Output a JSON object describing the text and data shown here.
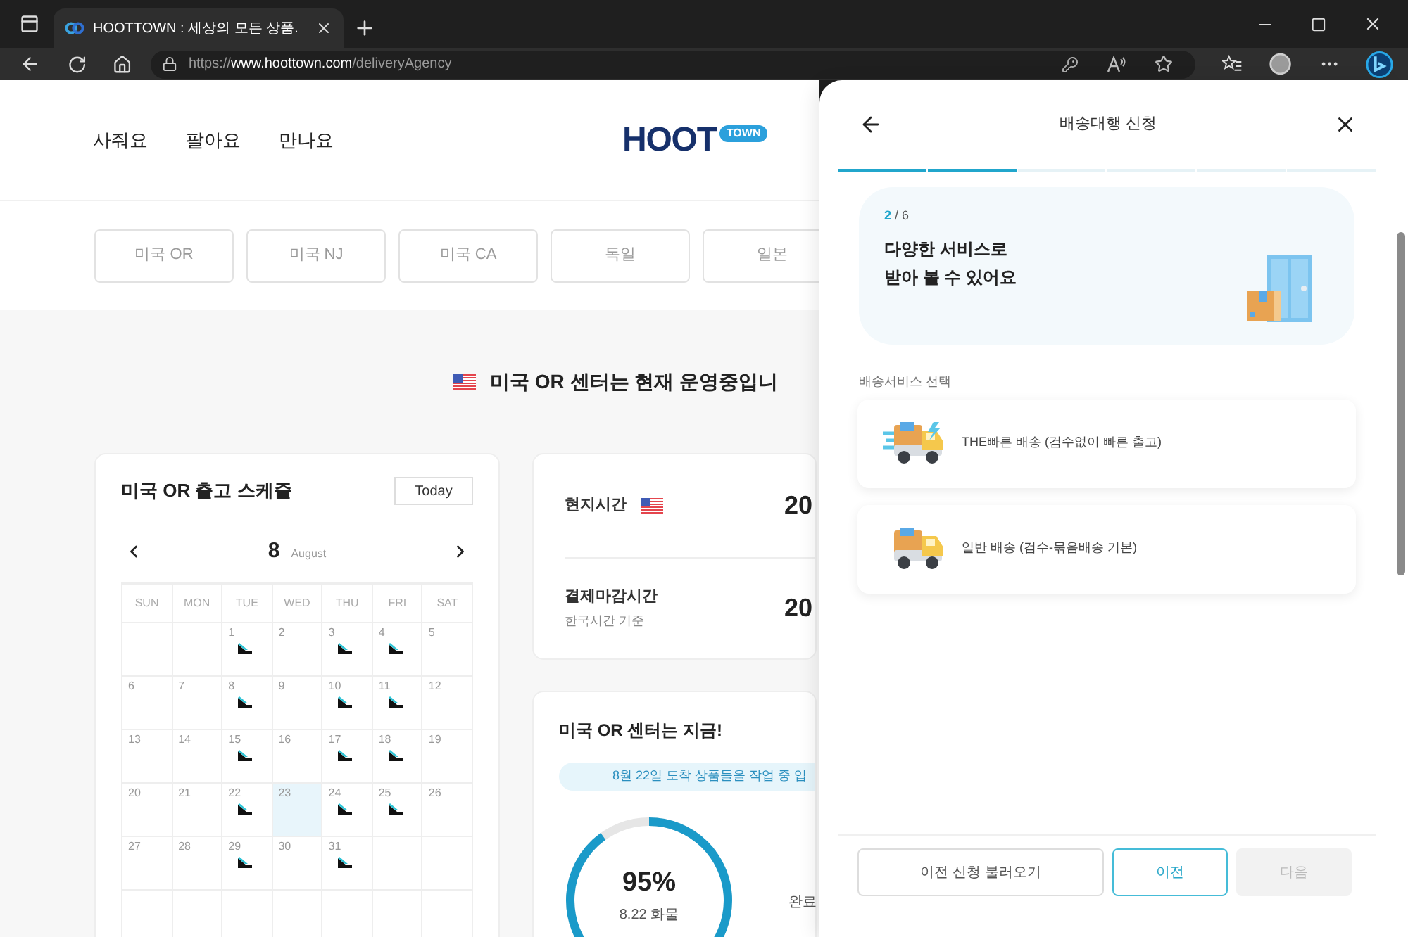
{
  "browser": {
    "tab_title": "HOOTTOWN : 세상의 모든 상품.",
    "url": {
      "scheme": "https://",
      "host": "www.hoottown.com",
      "path": "/deliveryAgency"
    }
  },
  "site": {
    "nav": [
      "사줘요",
      "팔아요",
      "만나요"
    ],
    "logo": {
      "main": "HOOT",
      "badge": "TOWN"
    },
    "countries": [
      {
        "label": "미국 OR",
        "selected": false
      },
      {
        "label": "미국 NJ",
        "selected": false
      },
      {
        "label": "미국 CA",
        "selected": false
      },
      {
        "label": "독일",
        "selected": false
      },
      {
        "label": "일본",
        "selected": false
      }
    ],
    "status_heading": "미국 OR 센터는 현재 운영중입니",
    "schedule": {
      "title": "미국 OR 출고 스케쥴",
      "today_button": "Today",
      "month_number": "8",
      "month_name": "August",
      "weekdays": [
        "SUN",
        "MON",
        "TUE",
        "WED",
        "THU",
        "FRI",
        "SAT"
      ],
      "weeks": [
        [
          {
            "kind": "blank"
          },
          {
            "kind": "blank"
          },
          {
            "kind": "day",
            "day": "1",
            "shipping": true,
            "selected": false
          },
          {
            "kind": "day",
            "day": "2",
            "shipping": false,
            "selected": false
          },
          {
            "kind": "day",
            "day": "3",
            "shipping": true,
            "selected": false
          },
          {
            "kind": "day",
            "day": "4",
            "shipping": true,
            "selected": false
          },
          {
            "kind": "day",
            "day": "5",
            "shipping": false,
            "selected": false
          }
        ],
        [
          {
            "kind": "day",
            "day": "6",
            "shipping": false,
            "selected": false
          },
          {
            "kind": "day",
            "day": "7",
            "shipping": false,
            "selected": false
          },
          {
            "kind": "day",
            "day": "8",
            "shipping": true,
            "selected": false
          },
          {
            "kind": "day",
            "day": "9",
            "shipping": false,
            "selected": false
          },
          {
            "kind": "day",
            "day": "10",
            "shipping": true,
            "selected": false
          },
          {
            "kind": "day",
            "day": "11",
            "shipping": true,
            "selected": false
          },
          {
            "kind": "day",
            "day": "12",
            "shipping": false,
            "selected": false
          }
        ],
        [
          {
            "kind": "day",
            "day": "13",
            "shipping": false,
            "selected": false
          },
          {
            "kind": "day",
            "day": "14",
            "shipping": false,
            "selected": false
          },
          {
            "kind": "day",
            "day": "15",
            "shipping": true,
            "selected": false
          },
          {
            "kind": "day",
            "day": "16",
            "shipping": false,
            "selected": false
          },
          {
            "kind": "day",
            "day": "17",
            "shipping": true,
            "selected": false
          },
          {
            "kind": "day",
            "day": "18",
            "shipping": true,
            "selected": false
          },
          {
            "kind": "day",
            "day": "19",
            "shipping": false,
            "selected": false
          }
        ],
        [
          {
            "kind": "day",
            "day": "20",
            "shipping": false,
            "selected": false
          },
          {
            "kind": "day",
            "day": "21",
            "shipping": false,
            "selected": false
          },
          {
            "kind": "day",
            "day": "22",
            "shipping": true,
            "selected": false
          },
          {
            "kind": "day",
            "day": "23",
            "shipping": false,
            "selected": true
          },
          {
            "kind": "day",
            "day": "24",
            "shipping": true,
            "selected": false
          },
          {
            "kind": "day",
            "day": "25",
            "shipping": true,
            "selected": false
          },
          {
            "kind": "day",
            "day": "26",
            "shipping": false,
            "selected": false
          }
        ],
        [
          {
            "kind": "day",
            "day": "27",
            "shipping": false,
            "selected": false
          },
          {
            "kind": "day",
            "day": "28",
            "shipping": false,
            "selected": false
          },
          {
            "kind": "day",
            "day": "29",
            "shipping": true,
            "selected": false
          },
          {
            "kind": "day",
            "day": "30",
            "shipping": false,
            "selected": false
          },
          {
            "kind": "day",
            "day": "31",
            "shipping": true,
            "selected": false
          },
          {
            "kind": "blank"
          },
          {
            "kind": "blank"
          }
        ],
        [
          {
            "kind": "blank"
          },
          {
            "kind": "blank"
          },
          {
            "kind": "blank"
          },
          {
            "kind": "blank"
          },
          {
            "kind": "blank"
          },
          {
            "kind": "blank"
          },
          {
            "kind": "blank"
          }
        ]
      ]
    },
    "times": [
      {
        "label": "현지시간",
        "value": "20",
        "flag": true
      },
      {
        "label": "결제마감시간",
        "note": "한국시간 기준",
        "value": "20",
        "flag": false
      }
    ],
    "center_now": {
      "title": "미국 OR 센터는 지금!",
      "banner": "8월 22일 도착 상품들을 작업 중 입",
      "percent": "95%",
      "caption": "8.22 화물",
      "side_label": "완료"
    }
  },
  "drawer": {
    "title": "배송대행 신청",
    "steps": [
      {
        "done": true
      },
      {
        "done": true
      },
      {
        "done": false
      },
      {
        "done": false
      },
      {
        "done": false
      },
      {
        "done": false
      }
    ],
    "step_current": "2",
    "step_total": "/ 6",
    "headline": [
      "다양한 서비스로",
      "받아 볼 수 있어요"
    ],
    "section_label": "배송서비스 선택",
    "options": [
      {
        "kind": "express",
        "label": "THE빠른 배송 (검수없이 빠른 출고)"
      },
      {
        "kind": "standard",
        "label": "일반 배송 (검수-묶음배송 기본)"
      }
    ],
    "buttons": [
      {
        "kind": "secondary",
        "label": "이전 신청 불러오기",
        "disabled": false
      },
      {
        "kind": "outline",
        "label": "이전",
        "disabled": false
      },
      {
        "kind": "primary",
        "label": "다음",
        "disabled": true
      }
    ]
  }
}
